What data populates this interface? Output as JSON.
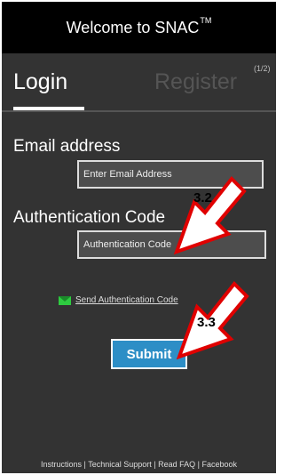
{
  "header": {
    "title": "Welcome to SNAC",
    "tm": "TM"
  },
  "tabs": {
    "login": "Login",
    "register": "Register",
    "step": "(1/2)"
  },
  "form": {
    "email_label": "Email address",
    "email_placeholder": "Enter Email Address",
    "auth_label": "Authentication Code",
    "auth_placeholder": "Authentication Code",
    "send_link": "Send Authentication Code",
    "submit_label": "Submit"
  },
  "callouts": {
    "first": "3.2",
    "second": "3.3"
  },
  "footer": {
    "links": "Instructions | Technical Support | Read FAQ | Facebook"
  },
  "colors": {
    "header_bg": "#000000",
    "panel_bg": "#333333",
    "submit_bg": "#2d8ec6",
    "arrow_fill": "#ffffff",
    "arrow_stroke": "#e00000"
  }
}
